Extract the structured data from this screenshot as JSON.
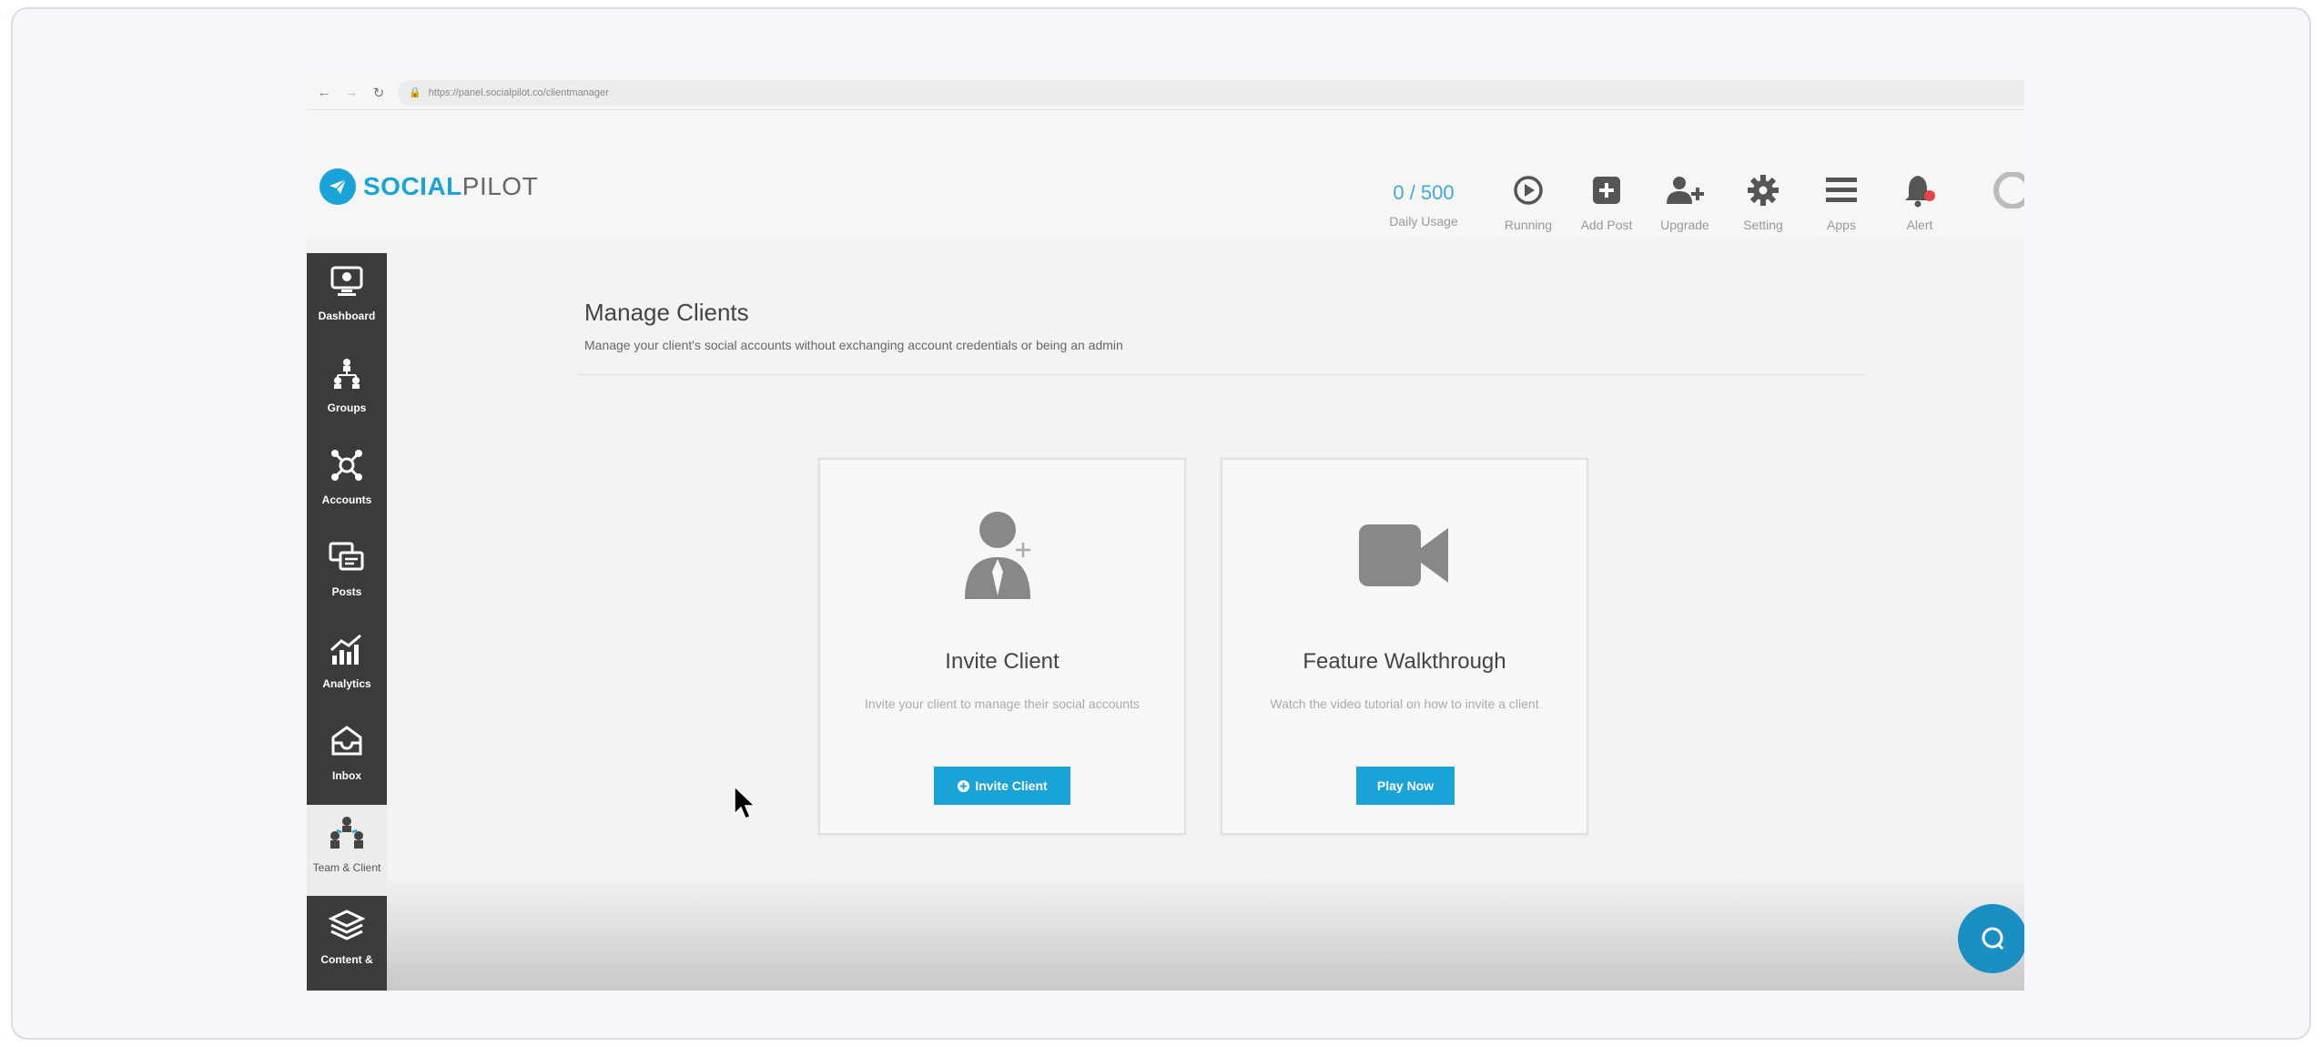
{
  "browser": {
    "url": "https://panel.socialpilot.co/clientmanager"
  },
  "brand": {
    "logo_bold": "SOCIAL",
    "logo_light": "PILOT",
    "accent_color": "#1aa3d6"
  },
  "header": {
    "usage_count": "0 / 500",
    "usage_label": "Daily Usage",
    "tools": [
      {
        "label": "Running",
        "icon": "play-circle-icon"
      },
      {
        "label": "Add Post",
        "icon": "plus-square-icon"
      },
      {
        "label": "Upgrade",
        "icon": "user-plus-icon"
      },
      {
        "label": "Setting",
        "icon": "gear-icon"
      },
      {
        "label": "Apps",
        "icon": "menu-icon"
      },
      {
        "label": "Alert",
        "icon": "bell-icon"
      }
    ]
  },
  "sidebar": {
    "items": [
      {
        "label": "Dashboard",
        "icon": "monitor-icon"
      },
      {
        "label": "Groups",
        "icon": "groups-icon"
      },
      {
        "label": "Accounts",
        "icon": "accounts-network-icon"
      },
      {
        "label": "Posts",
        "icon": "posts-icon"
      },
      {
        "label": "Analytics",
        "icon": "analytics-icon"
      },
      {
        "label": "Inbox",
        "icon": "inbox-icon"
      },
      {
        "label": "Team & Client",
        "icon": "team-client-icon",
        "active": true
      },
      {
        "label": "Content &",
        "icon": "content-layers-icon"
      }
    ]
  },
  "main": {
    "title": "Manage Clients",
    "subtitle": "Manage your client's social accounts without exchanging account credentials or being an admin",
    "cards": [
      {
        "title": "Invite Client",
        "description": "Invite your client to manage their social accounts",
        "button": "Invite Client",
        "icon": "user-add-icon"
      },
      {
        "title": "Feature Walkthrough",
        "description": "Watch the video tutorial on how to invite a client",
        "button": "Play Now",
        "icon": "video-camera-icon"
      }
    ]
  }
}
